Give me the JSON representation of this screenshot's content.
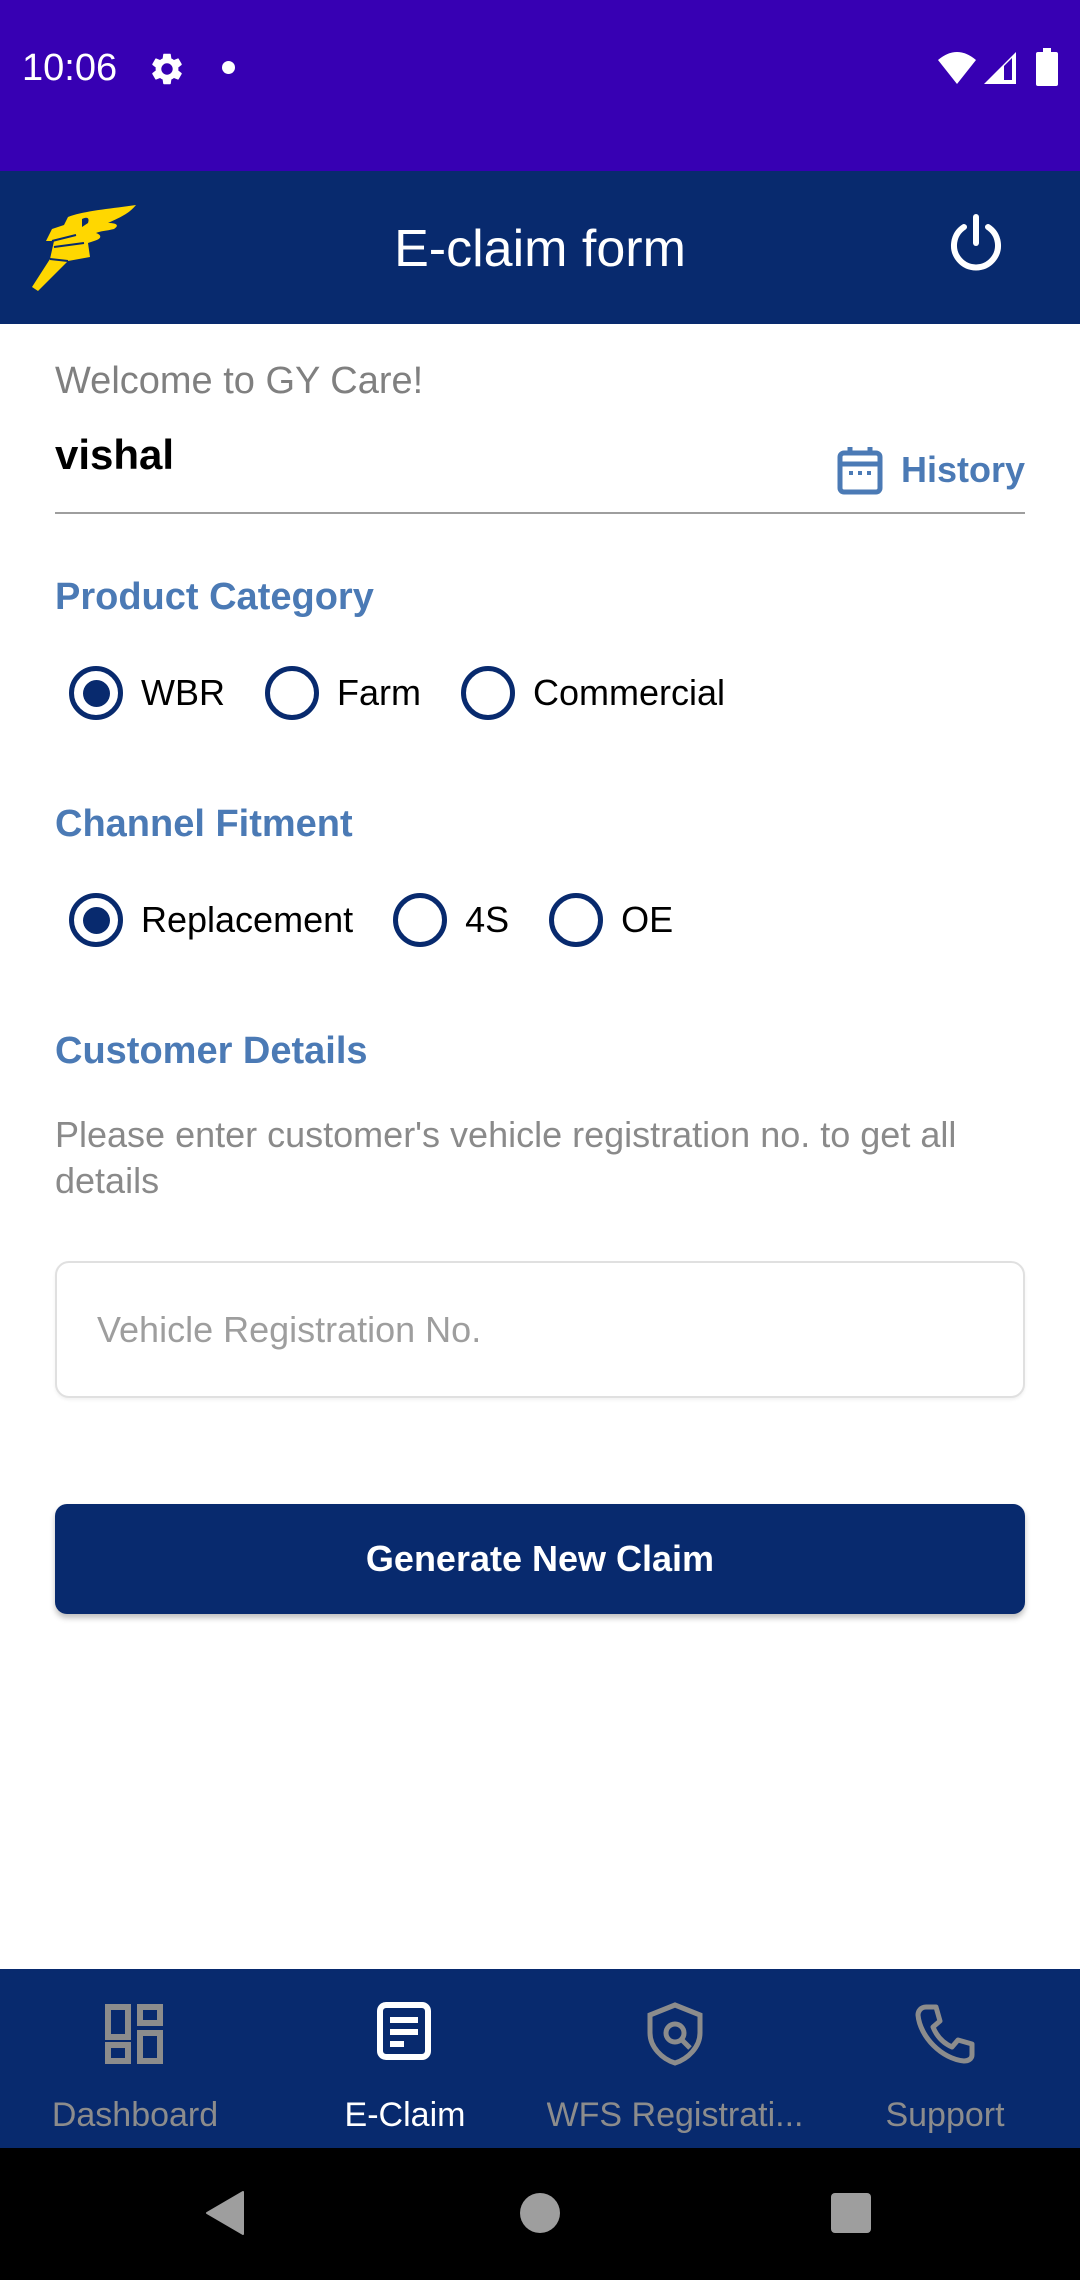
{
  "status_bar": {
    "time": "10:06",
    "icons": [
      "settings-gear-icon",
      "notification-dot-icon",
      "wifi-icon",
      "cell-signal-icon",
      "battery-icon"
    ]
  },
  "app_bar": {
    "title": "E-claim form",
    "logo": "goodyear-wingfoot-logo",
    "power_icon": "power-icon"
  },
  "colors": {
    "status_bar": "#3700B3",
    "primary": "#082A6E",
    "accent_text": "#4B7AB5",
    "logo_yellow": "#FFD700"
  },
  "user": {
    "welcome": "Welcome to GY Care!",
    "name": "vishal",
    "history_label": "History"
  },
  "product_category": {
    "title": "Product Category",
    "options": [
      {
        "label": "WBR",
        "selected": true
      },
      {
        "label": "Farm",
        "selected": false
      },
      {
        "label": "Commercial",
        "selected": false
      }
    ]
  },
  "channel_fitment": {
    "title": "Channel Fitment",
    "options": [
      {
        "label": "Replacement",
        "selected": true
      },
      {
        "label": "4S",
        "selected": false
      },
      {
        "label": "OE",
        "selected": false
      }
    ]
  },
  "customer_details": {
    "title": "Customer Details",
    "hint": "Please enter customer's vehicle registration no. to get all details",
    "reg_input": {
      "value": "",
      "placeholder": "Vehicle Registration No."
    },
    "submit_label": "Generate New Claim"
  },
  "bottom_nav": {
    "items": [
      {
        "label": "Dashboard",
        "icon": "dashboard-icon",
        "active": false
      },
      {
        "label": "E-Claim",
        "icon": "eclaim-document-icon",
        "active": true
      },
      {
        "label": "WFS Registrati...",
        "icon": "shield-search-icon",
        "active": false
      },
      {
        "label": "Support",
        "icon": "phone-icon",
        "active": false
      }
    ]
  }
}
